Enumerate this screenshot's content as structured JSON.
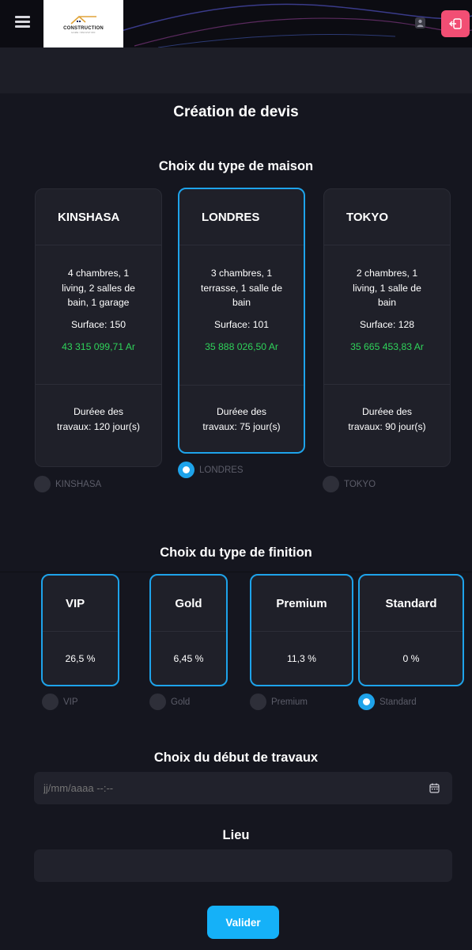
{
  "header": {
    "logo_text": "CONSTRUCTION",
    "logo_subtext": "GAME INNOVATION",
    "accent_color": "#f24e74"
  },
  "page_title": "Création de devis",
  "maison": {
    "title": "Choix du type de maison",
    "selected": "LONDRES",
    "cards": [
      {
        "name": "KINSHASA",
        "description": "4 chambres, 1 living, 2 salles de bain, 1 garage",
        "surface": "Surface: 150",
        "price": "43 315 099,71 Ar",
        "duree": "Duréee des travaux: 120 jour(s)",
        "radio_label": "KINSHASA"
      },
      {
        "name": "LONDRES",
        "description": "3 chambres, 1 terrasse, 1 salle de bain",
        "surface": "Surface: 101",
        "price": "35 888 026,50 Ar",
        "duree": "Duréee des travaux: 75 jour(s)",
        "radio_label": "LONDRES"
      },
      {
        "name": "TOKYO",
        "description": "2 chambres, 1 living, 1 salle de bain",
        "surface": "Surface: 128",
        "price": "35 665 453,83 Ar",
        "duree": "Duréee des travaux: 90 jour(s)",
        "radio_label": "TOKYO"
      }
    ]
  },
  "finition": {
    "title": "Choix du type de finition",
    "selected": "Standard",
    "cards": [
      {
        "name": "VIP",
        "value": "26,5 %",
        "radio_label": "VIP"
      },
      {
        "name": "Gold",
        "value": "6,45 %",
        "radio_label": "Gold"
      },
      {
        "name": "Premium",
        "value": "11,3 %",
        "radio_label": "Premium"
      },
      {
        "name": "Standard",
        "value": "0 %",
        "radio_label": "Standard"
      }
    ]
  },
  "debut": {
    "title": "Choix du début de travaux",
    "placeholder": "jj/mm/aaaa --:--"
  },
  "lieu": {
    "title": "Lieu",
    "value": ""
  },
  "submit_label": "Valider",
  "colors": {
    "primary": "#1ea3ea",
    "price": "#2fd35a",
    "background": "#15161f"
  }
}
